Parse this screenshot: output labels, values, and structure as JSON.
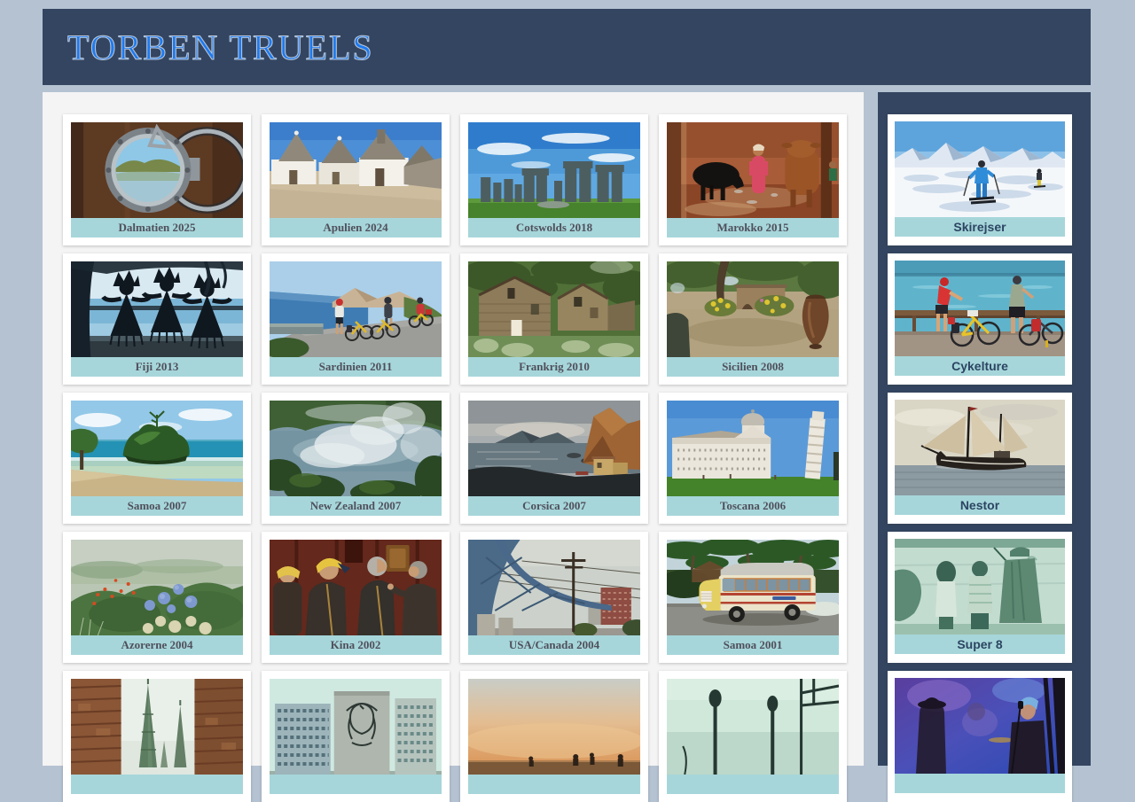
{
  "page": {
    "title": "TORBEN TRUELS"
  },
  "gallery": {
    "items": [
      {
        "label": "Dalmatien 2025",
        "image": "porthole-sea-view"
      },
      {
        "label": "Apulien 2024",
        "image": "trulli-houses"
      },
      {
        "label": "Cotswolds 2018",
        "image": "stonehenge"
      },
      {
        "label": "Marokko 2015",
        "image": "woman-with-cattle"
      },
      {
        "label": "Fiji 2013",
        "image": "dancer-silhouettes"
      },
      {
        "label": "Sardinien 2011",
        "image": "coastal-cyclists"
      },
      {
        "label": "Frankrig 2010",
        "image": "stone-houses"
      },
      {
        "label": "Sicilien 2008",
        "image": "garden-urn"
      },
      {
        "label": "Samoa 2007",
        "image": "lagoon-island"
      },
      {
        "label": "New Zealand 2007",
        "image": "steaming-crater"
      },
      {
        "label": "Corsica 2007",
        "image": "coast-cliffs"
      },
      {
        "label": "Toscana 2006",
        "image": "pisa-cathedral"
      },
      {
        "label": "Azorerne 2004",
        "image": "hydrangea-flowers"
      },
      {
        "label": "Kina 2002",
        "image": "people-yellow-caps"
      },
      {
        "label": "USA/Canada 2004",
        "image": "steel-bridge"
      },
      {
        "label": "Samoa 2001",
        "image": "island-bus"
      },
      {
        "label": "",
        "image": "church-spires"
      },
      {
        "label": "",
        "image": "havana-mural"
      },
      {
        "label": "",
        "image": "desert-sunset"
      },
      {
        "label": "",
        "image": "teal-silhouettes"
      }
    ]
  },
  "sidebar": {
    "items": [
      {
        "label": "Skirejser",
        "image": "ski-slope"
      },
      {
        "label": "Cykelture",
        "image": "cyclists-waterfront"
      },
      {
        "label": "Nestor",
        "image": "sailing-ship"
      },
      {
        "label": "Super 8",
        "image": "vintage-film-figures"
      },
      {
        "label": "",
        "image": "concert-stage"
      }
    ]
  },
  "colors": {
    "page_bg": "#b5c2d2",
    "panel_navy": "#334560",
    "content_bg": "#f4f4f4",
    "caption_teal": "#a6d6da",
    "title_blue": "#1d7af0",
    "caption_text": "#50505c",
    "sidebar_caption_text": "#2c4562"
  }
}
